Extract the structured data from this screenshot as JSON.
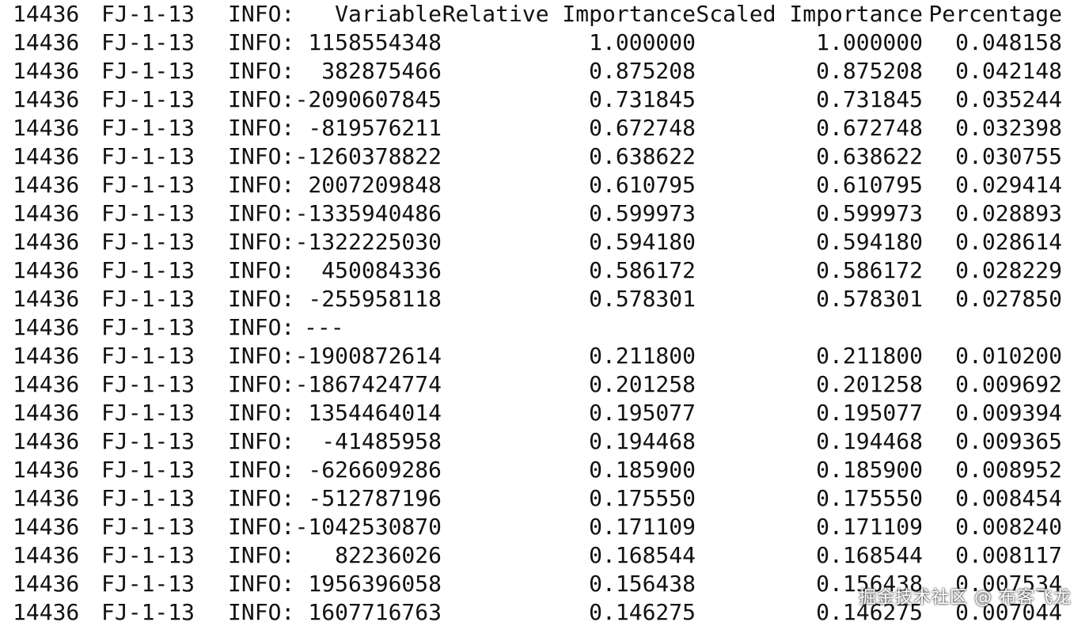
{
  "log": {
    "header": {
      "pid": "14436",
      "host": "FJ-1-13",
      "level": "INFO:",
      "columns": [
        "Variable",
        "Relative Importance",
        "Scaled Importance",
        "Percentage"
      ]
    },
    "rows": [
      {
        "pid": "14436",
        "host": "FJ-1-13",
        "level": "INFO:",
        "variable": "1158554348",
        "relative": "1.000000",
        "scaled": "1.000000",
        "percentage": "0.048158"
      },
      {
        "pid": "14436",
        "host": "FJ-1-13",
        "level": "INFO:",
        "variable": "382875466",
        "relative": "0.875208",
        "scaled": "0.875208",
        "percentage": "0.042148"
      },
      {
        "pid": "14436",
        "host": "FJ-1-13",
        "level": "INFO:",
        "variable": "-2090607845",
        "relative": "0.731845",
        "scaled": "0.731845",
        "percentage": "0.035244"
      },
      {
        "pid": "14436",
        "host": "FJ-1-13",
        "level": "INFO:",
        "variable": "-819576211",
        "relative": "0.672748",
        "scaled": "0.672748",
        "percentage": "0.032398"
      },
      {
        "pid": "14436",
        "host": "FJ-1-13",
        "level": "INFO:",
        "variable": "-1260378822",
        "relative": "0.638622",
        "scaled": "0.638622",
        "percentage": "0.030755"
      },
      {
        "pid": "14436",
        "host": "FJ-1-13",
        "level": "INFO:",
        "variable": "2007209848",
        "relative": "0.610795",
        "scaled": "0.610795",
        "percentage": "0.029414"
      },
      {
        "pid": "14436",
        "host": "FJ-1-13",
        "level": "INFO:",
        "variable": "-1335940486",
        "relative": "0.599973",
        "scaled": "0.599973",
        "percentage": "0.028893"
      },
      {
        "pid": "14436",
        "host": "FJ-1-13",
        "level": "INFO:",
        "variable": "-1322225030",
        "relative": "0.594180",
        "scaled": "0.594180",
        "percentage": "0.028614"
      },
      {
        "pid": "14436",
        "host": "FJ-1-13",
        "level": "INFO:",
        "variable": "450084336",
        "relative": "0.586172",
        "scaled": "0.586172",
        "percentage": "0.028229"
      },
      {
        "pid": "14436",
        "host": "FJ-1-13",
        "level": "INFO:",
        "variable": "-255958118",
        "relative": "0.578301",
        "scaled": "0.578301",
        "percentage": "0.027850"
      },
      {
        "pid": "14436",
        "host": "FJ-1-13",
        "level": "INFO:",
        "separator": "---"
      },
      {
        "pid": "14436",
        "host": "FJ-1-13",
        "level": "INFO:",
        "variable": "-1900872614",
        "relative": "0.211800",
        "scaled": "0.211800",
        "percentage": "0.010200"
      },
      {
        "pid": "14436",
        "host": "FJ-1-13",
        "level": "INFO:",
        "variable": "-1867424774",
        "relative": "0.201258",
        "scaled": "0.201258",
        "percentage": "0.009692"
      },
      {
        "pid": "14436",
        "host": "FJ-1-13",
        "level": "INFO:",
        "variable": "1354464014",
        "relative": "0.195077",
        "scaled": "0.195077",
        "percentage": "0.009394"
      },
      {
        "pid": "14436",
        "host": "FJ-1-13",
        "level": "INFO:",
        "variable": "-41485958",
        "relative": "0.194468",
        "scaled": "0.194468",
        "percentage": "0.009365"
      },
      {
        "pid": "14436",
        "host": "FJ-1-13",
        "level": "INFO:",
        "variable": "-626609286",
        "relative": "0.185900",
        "scaled": "0.185900",
        "percentage": "0.008952"
      },
      {
        "pid": "14436",
        "host": "FJ-1-13",
        "level": "INFO:",
        "variable": "-512787196",
        "relative": "0.175550",
        "scaled": "0.175550",
        "percentage": "0.008454"
      },
      {
        "pid": "14436",
        "host": "FJ-1-13",
        "level": "INFO:",
        "variable": "-1042530870",
        "relative": "0.171109",
        "scaled": "0.171109",
        "percentage": "0.008240"
      },
      {
        "pid": "14436",
        "host": "FJ-1-13",
        "level": "INFO:",
        "variable": "82236026",
        "relative": "0.168544",
        "scaled": "0.168544",
        "percentage": "0.008117"
      },
      {
        "pid": "14436",
        "host": "FJ-1-13",
        "level": "INFO:",
        "variable": "1956396058",
        "relative": "0.156438",
        "scaled": "0.156438",
        "percentage": "0.007534"
      },
      {
        "pid": "14436",
        "host": "FJ-1-13",
        "level": "INFO:",
        "variable": "1607716763",
        "relative": "0.146275",
        "scaled": "0.146275",
        "percentage": "0.007044"
      }
    ]
  },
  "watermark": "掘金技术社区 @ 布客飞龙"
}
